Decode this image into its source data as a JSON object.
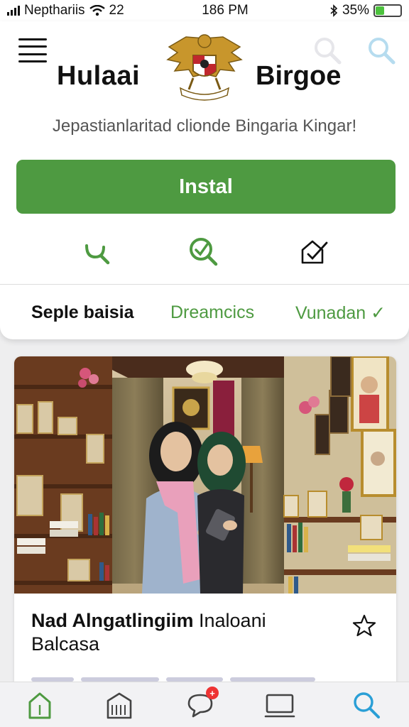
{
  "status_bar": {
    "carrier": "Nepthariis",
    "wifi_label": "22",
    "time": "186 PM",
    "battery": "35%",
    "battery_level": 0.35
  },
  "header": {
    "title_left": "Hulaai",
    "title_right": "Birgoe",
    "subtitle": "Jepastianlaritad clionde Bingaria Kingar!"
  },
  "install_button": {
    "label": "Instal"
  },
  "actions": [
    {
      "icon": "search-green-icon"
    },
    {
      "icon": "search-check-icon"
    },
    {
      "icon": "home-check-icon"
    }
  ],
  "tabs": [
    {
      "label": "Seple baisia",
      "active": true
    },
    {
      "label": "Dreamcics",
      "active": false
    },
    {
      "label": "Vunadan ✓",
      "active": false
    }
  ],
  "card": {
    "title_bold": "Nad Alngatlingiim",
    "title_rest": " Inaloani",
    "title_line2": "Balcasa"
  },
  "bottom_nav": [
    {
      "icon": "home-icon"
    },
    {
      "icon": "store-icon"
    },
    {
      "icon": "chat-icon",
      "badge": "+"
    },
    {
      "icon": "laptop-icon"
    },
    {
      "icon": "search-icon"
    }
  ],
  "colors": {
    "accent": "#4e9a41",
    "link": "#4e9a41",
    "search_blue": "#2a9fd6"
  }
}
